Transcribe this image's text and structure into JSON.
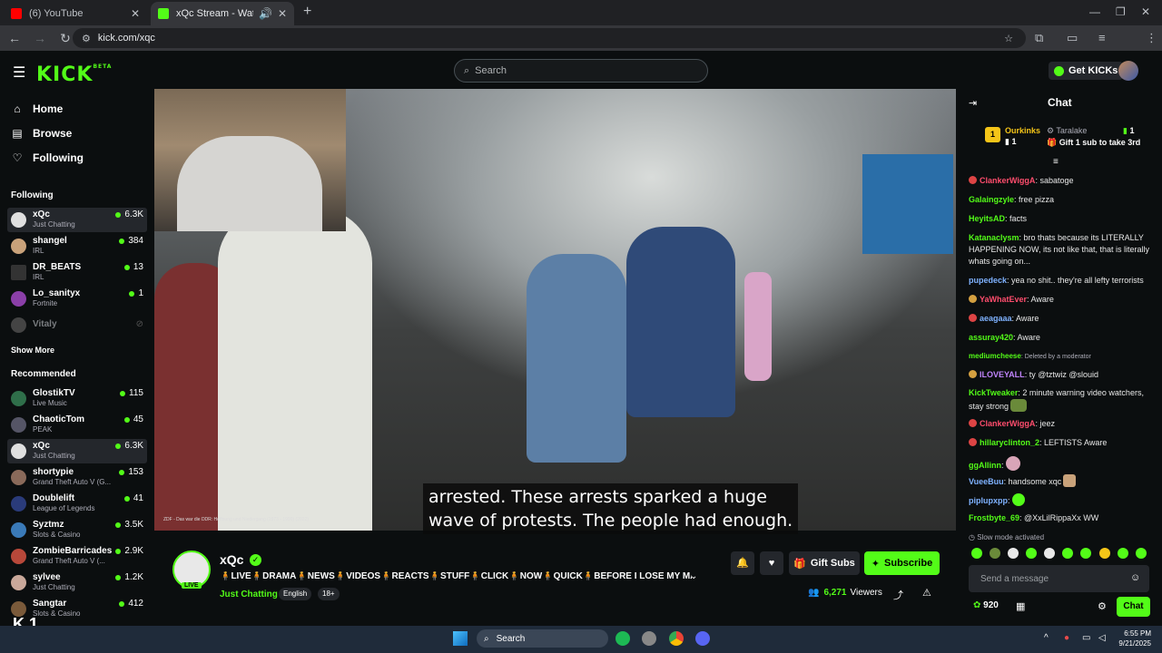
{
  "browser": {
    "tabs": [
      {
        "title": "(6) YouTube",
        "color": "#ff0000"
      },
      {
        "title": "xQc Stream - Watch Live on",
        "color": "#53fc18"
      }
    ],
    "url": "kick.com/xqc"
  },
  "header": {
    "logo": "KICK",
    "logo_sup": "BETA",
    "search_placeholder": "Search",
    "get_kicks": "Get KICKs"
  },
  "sidebar": {
    "nav": [
      {
        "label": "Home",
        "icon": "home-icon"
      },
      {
        "label": "Browse",
        "icon": "browse-icon"
      },
      {
        "label": "Following",
        "icon": "heart-icon"
      }
    ],
    "following_title": "Following",
    "following": [
      {
        "name": "xQc",
        "category": "Just Chatting",
        "viewers": "6.3K",
        "selected": true
      },
      {
        "name": "shangel",
        "category": "IRL",
        "viewers": "384"
      },
      {
        "name": "DR_BEATS",
        "category": "IRL",
        "viewers": "13"
      },
      {
        "name": "Lo_sanityx",
        "category": "Fortnite",
        "viewers": "1"
      },
      {
        "name": "Vitaly",
        "category": "",
        "viewers": "",
        "offline": true
      }
    ],
    "show_more": "Show More",
    "recommended_title": "Recommended",
    "recommended": [
      {
        "name": "GlostikTV",
        "category": "Live Music",
        "viewers": "115"
      },
      {
        "name": "ChaoticTom",
        "category": "PEAK",
        "viewers": "45"
      },
      {
        "name": "xQc",
        "category": "Just Chatting",
        "viewers": "6.3K",
        "selected": true
      },
      {
        "name": "shortypie",
        "category": "Grand Theft Auto V (G...",
        "viewers": "153"
      },
      {
        "name": "Doublelift",
        "category": "League of Legends",
        "viewers": "41"
      },
      {
        "name": "Syztmz",
        "category": "Slots & Casino",
        "viewers": "3.5K"
      },
      {
        "name": "ZombieBarricades",
        "category": "Grand Theft Auto V (...",
        "viewers": "2.9K"
      },
      {
        "name": "sylvee",
        "category": "Just Chatting",
        "viewers": "1.2K"
      },
      {
        "name": "Sangtar",
        "category": "Slots & Casino",
        "viewers": "412"
      }
    ],
    "bottom_badge": "K 1"
  },
  "video": {
    "caption_line1": "arrested. These arrests sparked a huge",
    "caption_line2": "wave of protests. The people had enough.",
    "source_note": "ZDF - Das war die DDR: Hoffnung und Niedergang (1973 - 1990) (2022)"
  },
  "stream": {
    "channel": "xQc",
    "live": "LIVE",
    "title": "🧍LIVE🧍DRAMA🧍NEWS🧍VIDEOS🧍REACTS🧍STUFF🧍CLICK🧍NOW🧍QUICK🧍BEFORE I LOSE MY MA...",
    "category": "Just Chatting",
    "tags": [
      "English",
      "18+"
    ],
    "gift_subs": "Gift Subs",
    "subscribe": "Subscribe",
    "viewers_count": "6,271",
    "viewers_label": "Viewers"
  },
  "chat": {
    "title": "Chat",
    "leaderboard": [
      {
        "name": "Ourkinks",
        "count": "1",
        "color": "#f5c518"
      },
      {
        "name": "Taralake",
        "count": "1",
        "color": "#adadb8"
      }
    ],
    "gift_banner": "Gift 1 sub to take 3rd",
    "messages": [
      {
        "user": "ClankerWiggA",
        "text": ": sabatoge",
        "color": "#ff4d6d"
      },
      {
        "user": "Galaingzyle",
        "text": ": free pizza",
        "color": "#53fc18"
      },
      {
        "user": "HeyitsAD",
        "text": ": facts",
        "color": "#53fc18"
      },
      {
        "user": "Katanaclysm",
        "text": ": bro thats because its LITERALLY HAPPENING NOW, its not like that, that is literally whats going on...",
        "color": "#53fc18"
      },
      {
        "user": "pupedeck",
        "text": ": yea no shit.. they're all lefty terrorists",
        "color": "#7fb2ff"
      },
      {
        "user": "YaWhatEver",
        "text": ": Aware",
        "color": "#ff4d6d"
      },
      {
        "user": "aeagaaa",
        "text": ": Aware",
        "color": "#7fb2ff"
      },
      {
        "user": "assuray420",
        "text": ": Aware",
        "color": "#53fc18"
      },
      {
        "user": "mediumcheese",
        "text": ": Deleted by a moderator",
        "color": "#53fc18"
      },
      {
        "user": "ILOVEYALL",
        "text": ": ty @tztwiz @slouid",
        "color": "#c084fc"
      },
      {
        "user": "KickTweaker",
        "text": ": 2 minute warning video watchers, stay strong",
        "color": "#53fc18"
      },
      {
        "user": "ClankerWiggA",
        "text": ": jeez",
        "color": "#ff4d6d"
      },
      {
        "user": "hillaryclinton_2",
        "text": ": LEFTISTS Aware",
        "color": "#53fc18"
      },
      {
        "user": "ggAllinn",
        "text": ":",
        "color": "#53fc18"
      },
      {
        "user": "VueeBuu",
        "text": ": handsome xqc",
        "color": "#7fb2ff"
      },
      {
        "user": "piplupxpp",
        "text": ":",
        "color": "#7fb2ff"
      },
      {
        "user": "Frostbyte_69",
        "text": ": @XxLilRippaXx WW",
        "color": "#53fc18"
      }
    ],
    "slow_mode": "Slow mode activated",
    "input_placeholder": "Send a message",
    "points": "920",
    "send_button": "Chat"
  },
  "taskbar": {
    "search": "Search",
    "time": "6:55 PM",
    "date": "9/21/2025"
  }
}
